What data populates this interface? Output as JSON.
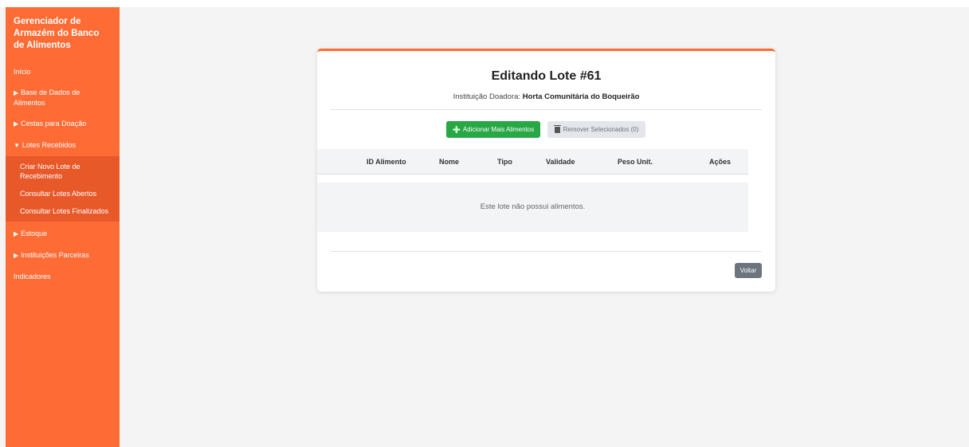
{
  "sidebar": {
    "brand": "Gerenciador de Armazém do Banco de Alimentos",
    "items": [
      {
        "label": "Início",
        "caret": ""
      },
      {
        "label": "Base de Dados de Alimentos",
        "caret": "▶"
      },
      {
        "label": "Cestas para Doação",
        "caret": "▶"
      },
      {
        "label": "Lotes Recebidos",
        "caret": "▼"
      },
      {
        "label": "Estoque",
        "caret": "▶"
      },
      {
        "label": "Instituições Parceiras",
        "caret": "▶"
      },
      {
        "label": "Indicadores",
        "caret": ""
      }
    ],
    "submenu": [
      {
        "label": "Criar Novo Lote de Recebimento"
      },
      {
        "label": "Consultar Lotes Abertos"
      },
      {
        "label": "Consultar Lotes Finalizados"
      }
    ]
  },
  "card": {
    "title": "Editando Lote #61",
    "donor_label": "Instituição Doadora:",
    "donor_name": "Horta Comunitária do Boqueirão",
    "add_button": "Adicionar Mais Alimentos",
    "remove_button": "Remover Selecionados (0)",
    "columns": [
      "ID Alimento",
      "Nome",
      "Tipo",
      "Validade",
      "Peso Unit.",
      "Ações"
    ],
    "empty_message": "Este lote não possui alimentos.",
    "back_button": "Voltar"
  },
  "colors": {
    "accent": "#ff6b35",
    "success": "#28a745",
    "secondary": "#6c757d"
  }
}
